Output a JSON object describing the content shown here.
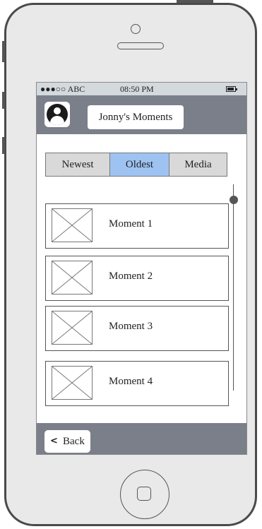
{
  "status_bar": {
    "carrier": "●●●○○ ABC",
    "time": "08:50 PM",
    "battery_icon": "battery-icon"
  },
  "header": {
    "avatar_icon": "user-avatar-icon",
    "title": "Jonny's Moments"
  },
  "tabs": [
    {
      "label": "Newest",
      "active": false
    },
    {
      "label": "Oldest",
      "active": true
    },
    {
      "label": "Media",
      "active": false
    }
  ],
  "moments": [
    {
      "label": "Moment 1",
      "image_icon": "image-placeholder-icon"
    },
    {
      "label": "Moment 2",
      "image_icon": "image-placeholder-icon"
    },
    {
      "label": "Moment 3",
      "image_icon": "image-placeholder-icon"
    },
    {
      "label": "Moment 4",
      "image_icon": "image-placeholder-icon"
    }
  ],
  "footer": {
    "back_label": "Back",
    "back_icon": "chevron-left-icon"
  },
  "colors": {
    "bar_bg": "#7a7f8a",
    "status_bg": "#d4d9de",
    "tab_active": "#9ec3f2",
    "tab_inactive": "#d9d9d9"
  }
}
